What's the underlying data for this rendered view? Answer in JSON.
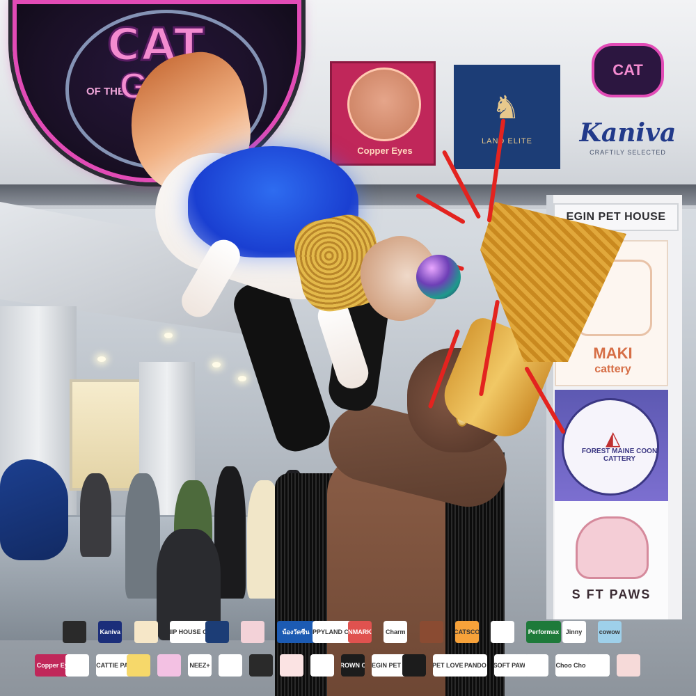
{
  "signs": {
    "galaxy_title": "CAT",
    "galaxy_of": "OF THE",
    "galaxy_sub": "GALA",
    "copper_eyes": "Copper Eyes",
    "landmark": "LAND  ELITE",
    "kaniva_badge": "CAT",
    "kaniva_word": "Kaniva",
    "kaniva_tag": "CRAFTILY SELECTED",
    "begin_pet_house": "EGIN PET HOUSE",
    "maki_name": "MAKI",
    "maki_sub": "cattery",
    "maine_coon": "FOREST MAINE COON CATTERY",
    "soft_paws": "S  FT PAWS"
  },
  "sponsors_row1": [
    {
      "text": "",
      "color": "#2a2a2a"
    },
    {
      "text": "Kaniva",
      "color": "#1b2e7a"
    },
    {
      "text": "",
      "color": "#f6e7c8"
    },
    {
      "text": "CATNIP HOUSE CAT CAFE",
      "color": "#ffffff"
    },
    {
      "text": "",
      "color": "#1c3d76"
    },
    {
      "text": "",
      "color": "#f3d2d8"
    },
    {
      "text": "น้องวัคซีน",
      "color": "#1c5bb3"
    },
    {
      "text": "HAPPYLAND CENTER",
      "color": "#ffffff"
    },
    {
      "text": "NMARK",
      "color": "#e0524f"
    },
    {
      "text": "Charm",
      "color": "#ffffff"
    },
    {
      "text": "",
      "color": "#8a4b32"
    },
    {
      "text": "CATSCO",
      "color": "#f7a23a"
    },
    {
      "text": "",
      "color": "#ffffff"
    },
    {
      "text": "Performax",
      "color": "#1e7a3a"
    },
    {
      "text": "Jinny",
      "color": "#ffffff"
    },
    {
      "text": "cowow",
      "color": "#9ed0ea"
    }
  ],
  "sponsors_row2": [
    {
      "text": "Copper Eyes",
      "color": "#c0275a"
    },
    {
      "text": "",
      "color": "#ffffff"
    },
    {
      "text": "CATTIE PAWS",
      "color": "#ffffff"
    },
    {
      "text": "",
      "color": "#f6d86a"
    },
    {
      "text": "",
      "color": "#f3c1e3"
    },
    {
      "text": "NEEZ+",
      "color": "#ffffff"
    },
    {
      "text": "",
      "color": "#ffffff"
    },
    {
      "text": "",
      "color": "#2a2a2a"
    },
    {
      "text": "",
      "color": "#fbe3e3"
    },
    {
      "text": "",
      "color": "#ffffff"
    },
    {
      "text": "CROWN OF",
      "color": "#1c1c1c"
    },
    {
      "text": "BEGIN PET HOUSE",
      "color": "#ffffff"
    },
    {
      "text": "",
      "color": "#1c1c1c"
    },
    {
      "text": "PET LOVERS",
      "color": "#ffffff"
    },
    {
      "text": "PANDO",
      "color": "#ffffff"
    },
    {
      "text": "SOFT PAWS",
      "color": "#ffffff"
    },
    {
      "text": "",
      "color": "#ffffff"
    },
    {
      "text": "Choo Choo",
      "color": "#ffffff"
    },
    {
      "text": "",
      "color": "#ffffff"
    },
    {
      "text": "",
      "color": "#f6dad9"
    }
  ]
}
